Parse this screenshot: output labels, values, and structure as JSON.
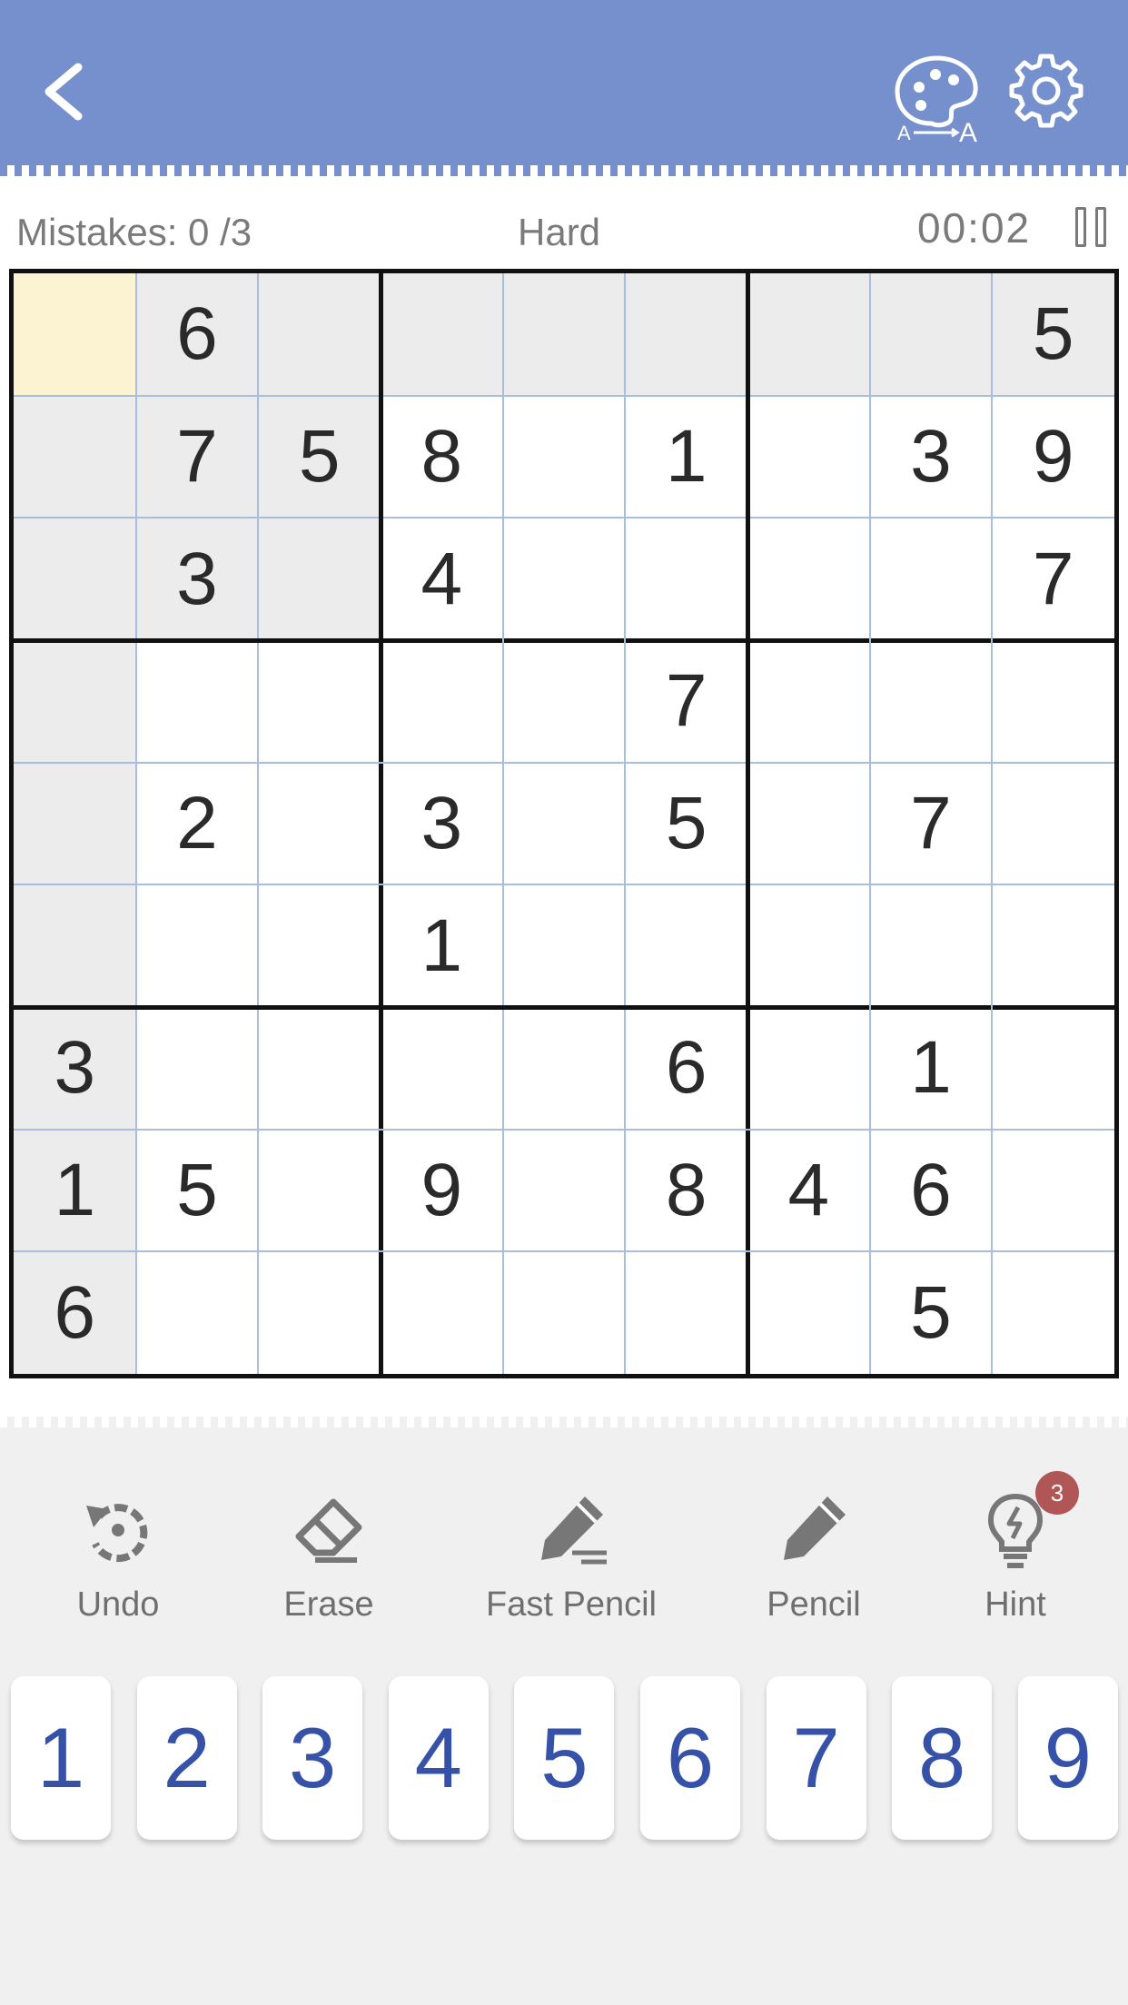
{
  "header": {
    "bg_color": "#7590cc",
    "back_icon": "chevron-left-icon",
    "theme_icon": "palette-icon",
    "settings_icon": "gear-icon"
  },
  "status": {
    "mistakes_label": "Mistakes: 0 /3",
    "difficulty": "Hard",
    "timer": "00:02",
    "pause_icon": "pause-icon"
  },
  "board": {
    "grid": [
      [
        "",
        "6",
        "",
        "",
        "",
        "",
        "",
        "",
        "5"
      ],
      [
        "",
        "7",
        "5",
        "8",
        "",
        "1",
        "",
        "3",
        "9"
      ],
      [
        "",
        "3",
        "",
        "4",
        "",
        "",
        "",
        "",
        "7"
      ],
      [
        "",
        "",
        "",
        "",
        "",
        "7",
        "",
        "",
        ""
      ],
      [
        "",
        "2",
        "",
        "3",
        "",
        "5",
        "",
        "7",
        ""
      ],
      [
        "",
        "",
        "",
        "1",
        "",
        "",
        "",
        "",
        ""
      ],
      [
        "3",
        "",
        "",
        "",
        "",
        "6",
        "",
        "1",
        ""
      ],
      [
        "1",
        "5",
        "",
        "9",
        "",
        "8",
        "4",
        "6",
        ""
      ],
      [
        "6",
        "",
        "",
        "",
        "",
        "",
        "",
        "5",
        ""
      ]
    ],
    "selected": [
      0,
      0
    ],
    "selected_color": "#fbf3d1",
    "highlight_color": "#ececec"
  },
  "toolbar": {
    "undo_label": "Undo",
    "erase_label": "Erase",
    "fast_pencil_label": "Fast Pencil",
    "pencil_label": "Pencil",
    "hint_label": "Hint",
    "hint_count": "3"
  },
  "numpad": [
    "1",
    "2",
    "3",
    "4",
    "5",
    "6",
    "7",
    "8",
    "9"
  ]
}
